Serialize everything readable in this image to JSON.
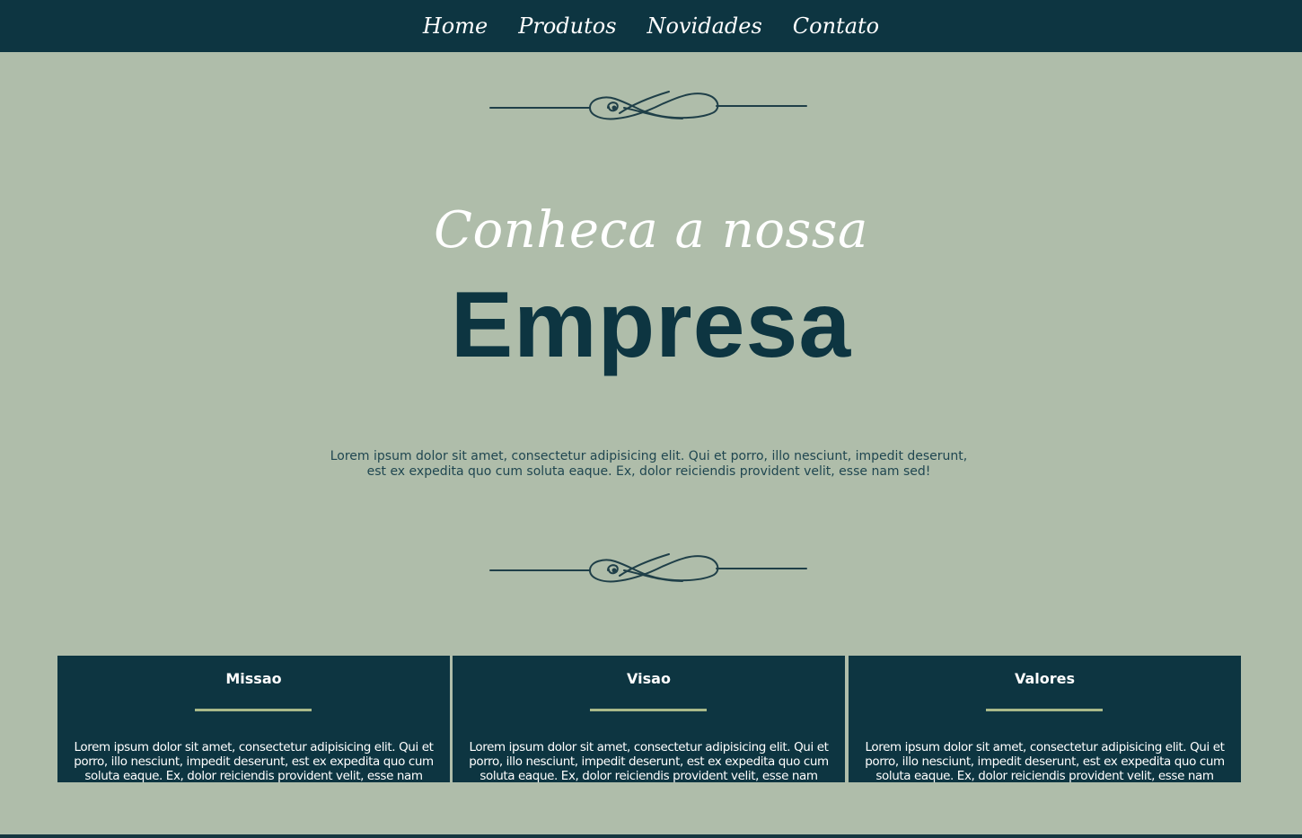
{
  "nav": {
    "items": [
      {
        "label": "Home"
      },
      {
        "label": "Produtos"
      },
      {
        "label": "Novidades"
      },
      {
        "label": "Contato"
      }
    ]
  },
  "hero": {
    "kicker": "Conheca a nossa",
    "title": "Empresa",
    "text": "Lorem ipsum dolor sit amet, consectetur adipisicing elit. Qui et porro, illo nesciunt, impedit deserunt, est ex expedita quo cum soluta eaque. Ex, dolor reiciendis provident velit, esse nam sed!"
  },
  "cards": [
    {
      "title": "Missao",
      "text": "Lorem ipsum dolor sit amet, consectetur adipisicing elit. Qui et porro, illo nesciunt, impedit deserunt, est ex expedita quo cum soluta eaque. Ex, dolor reiciendis provident velit, esse nam sed!"
    },
    {
      "title": "Visao",
      "text": "Lorem ipsum dolor sit amet, consectetur adipisicing elit. Qui et porro, illo nesciunt, impedit deserunt, est ex expedita quo cum soluta eaque. Ex, dolor reiciendis provident velit, esse nam sed!"
    },
    {
      "title": "Valores",
      "text": "Lorem ipsum dolor sit amet, consectetur adipisicing elit. Qui et porro, illo nesciunt, impedit deserunt, est ex expedita quo cum soluta eaque. Ex, dolor reiciendis provident velit, esse nam sed!"
    }
  ],
  "colors": {
    "background": "#afbdaa",
    "primary": "#0d3541",
    "accent": "#a9b989",
    "text_light": "#ffffff"
  },
  "icons": {
    "divider": "flourish-divider-icon"
  }
}
